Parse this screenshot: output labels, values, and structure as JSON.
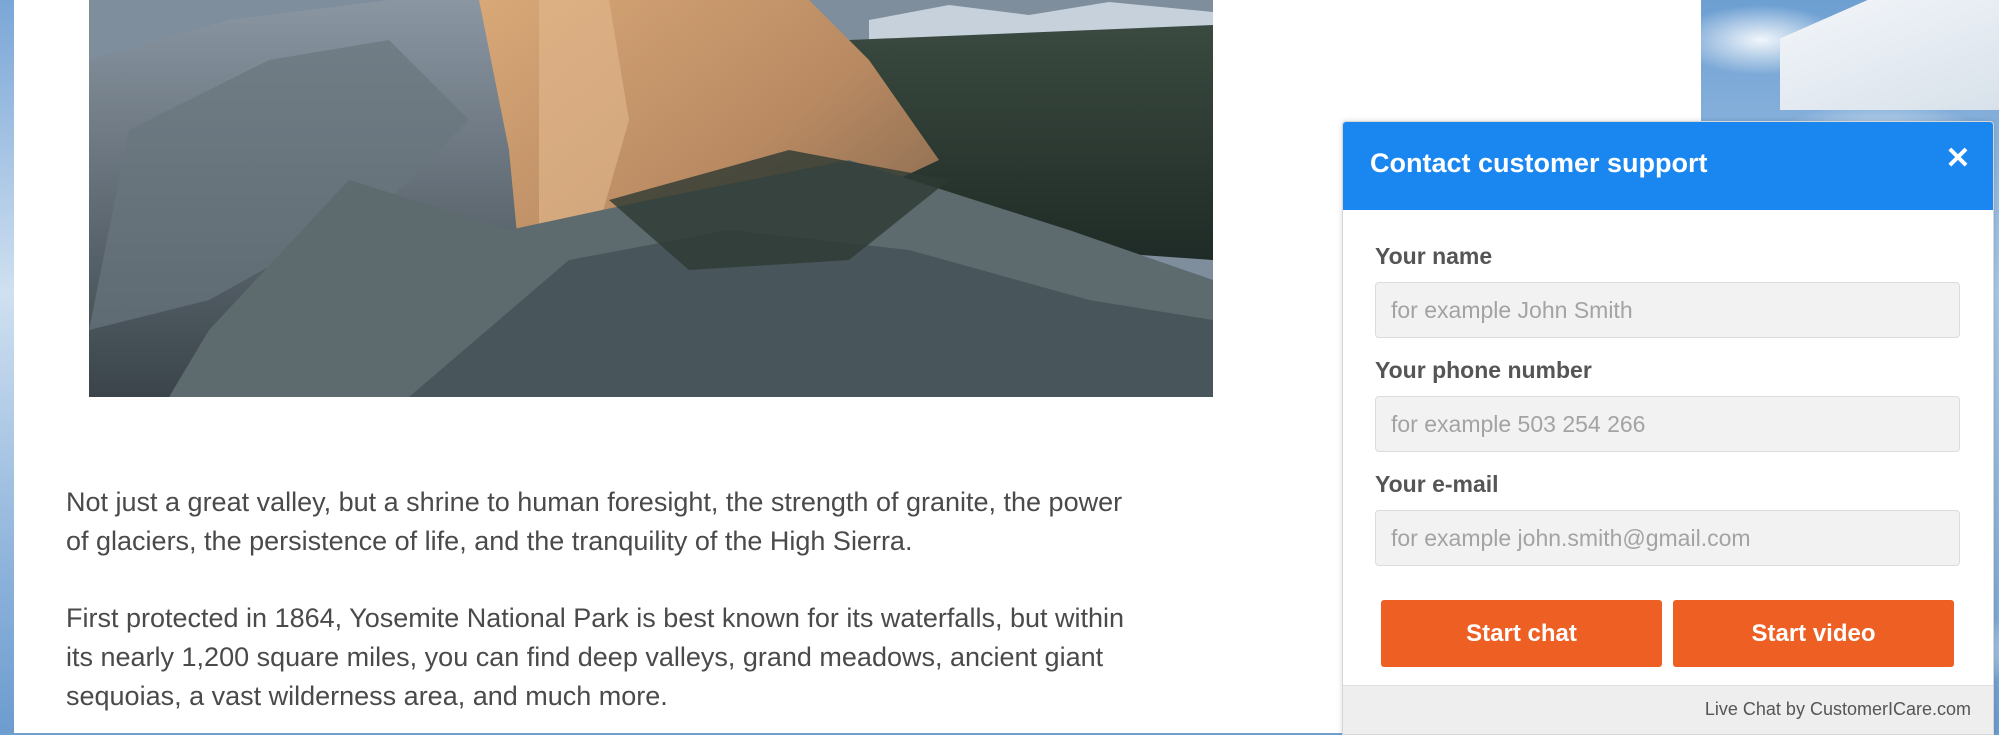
{
  "article": {
    "paragraph_1": "Not just a great valley, but a shrine to human foresight, the strength of granite, the power of glaciers, the persistence of life, and the tranquility of the High Sierra.",
    "paragraph_2": "First protected in 1864, Yosemite National Park is best known for its waterfalls, but within its nearly 1,200 square miles, you can find deep valleys, grand meadows, ancient giant sequoias, a vast wilderness area, and much more."
  },
  "widget": {
    "title": "Contact customer support",
    "close_icon": "close-icon",
    "name_label": "Your name",
    "name_placeholder": "for example John Smith",
    "phone_label": "Your phone number",
    "phone_placeholder": "for example 503 254 266",
    "email_label": "Your e-mail",
    "email_placeholder": "for example john.smith@gmail.com",
    "start_chat_label": "Start chat",
    "start_video_label": "Start video",
    "footer_text": "Live Chat by CustomerICare.com"
  },
  "colors": {
    "header_blue": "#1a86f0",
    "button_orange": "#ee5f23"
  }
}
